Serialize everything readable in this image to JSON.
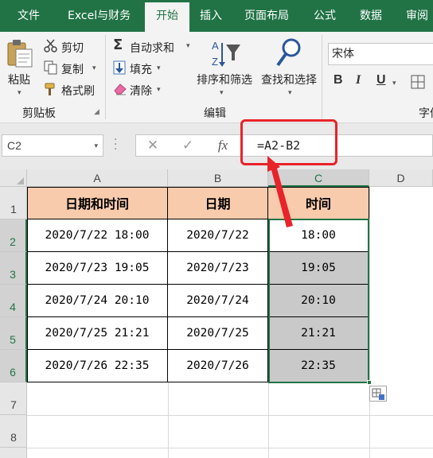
{
  "tabs": [
    {
      "label": "文件",
      "active": false
    },
    {
      "label": "Excel与财务",
      "active": false
    },
    {
      "label": "开始",
      "active": true
    },
    {
      "label": "插入",
      "active": false
    },
    {
      "label": "页面布局",
      "active": false
    },
    {
      "label": "公式",
      "active": false
    },
    {
      "label": "数据",
      "active": false
    },
    {
      "label": "审阅",
      "active": false
    }
  ],
  "ribbon": {
    "clipboard": {
      "paste": "粘贴",
      "cut": "剪切",
      "copy": "复制",
      "format_painter": "格式刷",
      "group_label": "剪贴板"
    },
    "editing": {
      "autosum": "自动求和",
      "fill": "填充",
      "clear": "清除",
      "sort_filter": "排序和筛选",
      "find_select": "查找和选择",
      "group_label": "编辑"
    },
    "font": {
      "font_name": "宋体",
      "bold": "B",
      "italic": "I",
      "underline": "U",
      "group_label": "字体"
    }
  },
  "formula_bar": {
    "name_box": "C2",
    "cancel": "✕",
    "enter": "✓",
    "fx": "fx",
    "formula": "=A2-B2"
  },
  "grid": {
    "columns": [
      "A",
      "B",
      "C",
      "D"
    ],
    "rows": [
      "1",
      "2",
      "3",
      "4",
      "5",
      "6",
      "7",
      "8"
    ],
    "selected_column": "C",
    "active_cell": "C2",
    "header_row": [
      "日期和时间",
      "日期",
      "时间"
    ],
    "data": [
      [
        "2020/7/22  18:00",
        "2020/7/22",
        "18:00"
      ],
      [
        "2020/7/23  19:05",
        "2020/7/23",
        "19:05"
      ],
      [
        "2020/7/24  20:10",
        "2020/7/24",
        "20:10"
      ],
      [
        "2020/7/25  21:21",
        "2020/7/25",
        "21:21"
      ],
      [
        "2020/7/26  22:35",
        "2020/7/26",
        "22:35"
      ]
    ]
  },
  "colors": {
    "excel_green": "#217346",
    "header_fill": "#f8cbad",
    "selection_fill": "#c9c9c9",
    "annotation_red": "#e8232a"
  },
  "icons": [
    "paste-icon",
    "scissors-icon",
    "copy-icon",
    "format-painter-icon",
    "sigma-icon",
    "fill-down-icon",
    "eraser-icon",
    "sort-filter-icon",
    "find-magnifier-icon",
    "quick-analysis-icon"
  ]
}
